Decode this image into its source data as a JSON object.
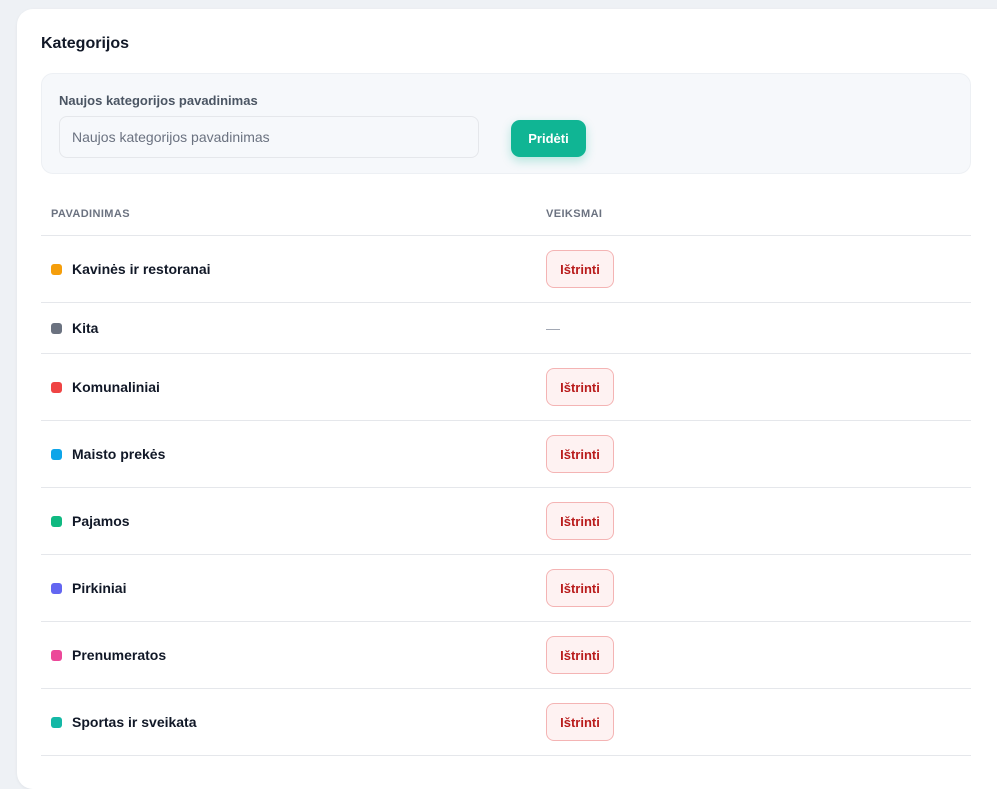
{
  "page": {
    "title": "Kategorijos"
  },
  "add_form": {
    "label": "Naujos kategorijos pavadinimas",
    "input_value": "",
    "input_placeholder": "Naujos kategorijos pavadinimas",
    "button_label": "Pridėti"
  },
  "table": {
    "headers": {
      "name": "PAVADINIMAS",
      "actions": "VEIKSMAI"
    },
    "rows": [
      {
        "name": "Kavinės ir restoranai",
        "color": "#f59e0b",
        "action": "Ištrinti"
      },
      {
        "name": "Kita",
        "color": "#6b7280",
        "action": "—"
      },
      {
        "name": "Komunaliniai",
        "color": "#ef4444",
        "action": "Ištrinti"
      },
      {
        "name": "Maisto prekės",
        "color": "#0ea5e9",
        "action": "Ištrinti"
      },
      {
        "name": "Pajamos",
        "color": "#10b981",
        "action": "Ištrinti"
      },
      {
        "name": "Pirkiniai",
        "color": "#6366f1",
        "action": "Ištrinti"
      },
      {
        "name": "Prenumeratos",
        "color": "#ec4899",
        "action": "Ištrinti"
      },
      {
        "name": "Sportas ir sveikata",
        "color": "#14b8a6",
        "action": "Ištrinti"
      }
    ]
  },
  "colors": {
    "accent": "#10b594",
    "danger": "#b91c1c",
    "danger_bg": "#fef2f2"
  }
}
